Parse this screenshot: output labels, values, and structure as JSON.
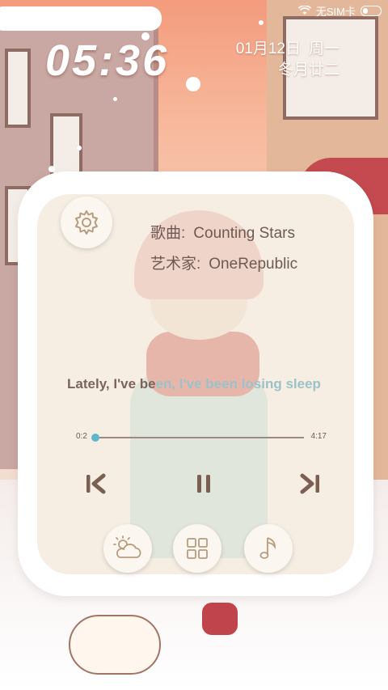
{
  "status": {
    "carrier": "无SIM卡"
  },
  "clock": {
    "time": "05:36"
  },
  "date": {
    "date": "01月12日",
    "weekday": "周一",
    "lunar": "冬月廿二"
  },
  "song": {
    "title_label": "歌曲:",
    "title": "Counting Stars",
    "artist_label": "艺术家:",
    "artist": "OneRepublic"
  },
  "lyric": {
    "played": "Lately, I've be",
    "rest": "en, I've been losing sleep"
  },
  "progress": {
    "current": "0:2",
    "total": "4:17",
    "fraction": 0.01
  },
  "icons": {
    "settings": "gear-icon",
    "previous": "skip-previous-icon",
    "pause": "pause-icon",
    "next": "skip-next-icon",
    "weather": "weather-icon",
    "apps": "grid-icon",
    "music": "music-note-icon"
  },
  "colors": {
    "accent": "#5fb6cc",
    "icon": "#7a5f52",
    "text": "#6e5a52"
  }
}
